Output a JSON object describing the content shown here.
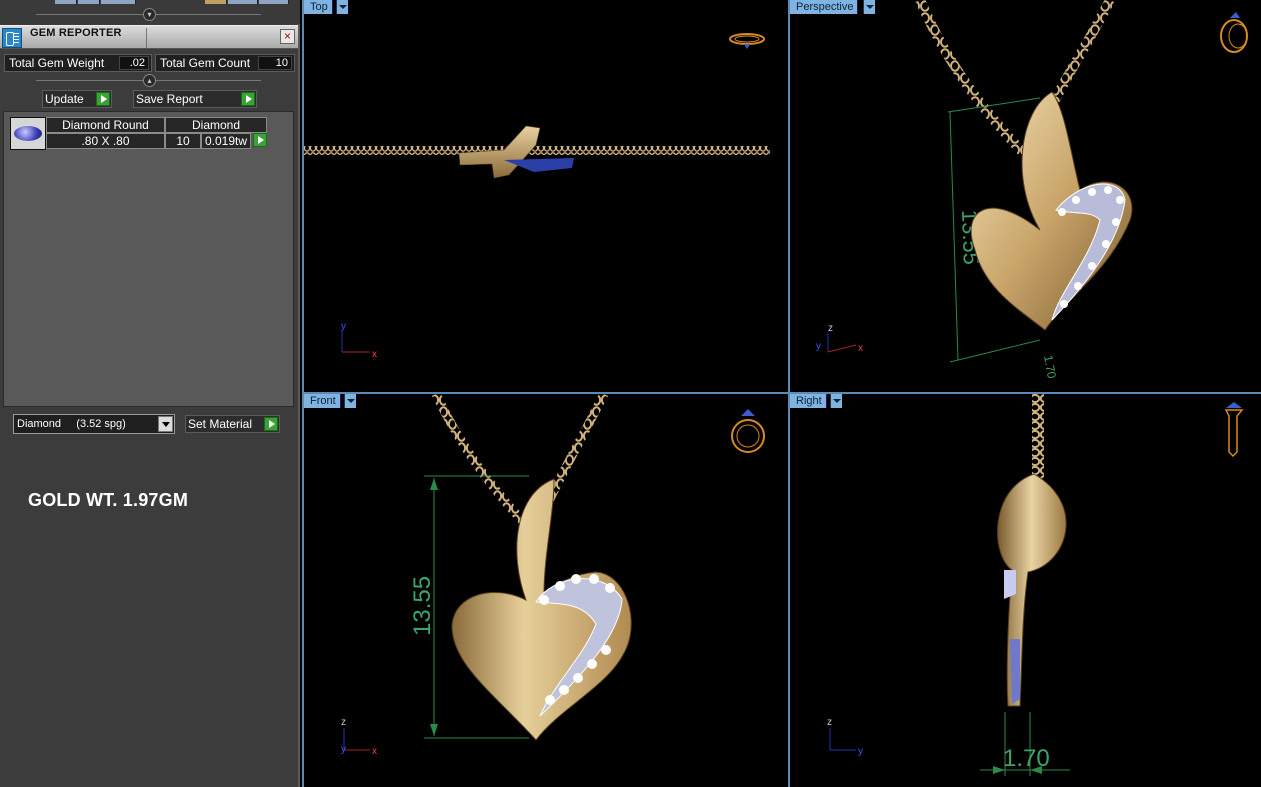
{
  "panel": {
    "title": "GEM REPORTER",
    "total_gem_weight_label": "Total Gem Weight",
    "total_gem_weight_value": ".02",
    "total_gem_count_label": "Total Gem Count",
    "total_gem_count_value": "10",
    "update_label": "Update",
    "save_report_label": "Save Report",
    "gem_row": {
      "shape_header": "Diamond Round",
      "type_header": "Diamond",
      "size": ".80 X .80",
      "count": "10",
      "weight": "0.019tw"
    },
    "material_select": "Diamond     (3.52 spg)",
    "set_material_label": "Set Material",
    "gold_weight_note": "GOLD WT. 1.97GM"
  },
  "viewports": {
    "top": {
      "label": "Top",
      "axis_a": "y",
      "axis_b": "x"
    },
    "perspective": {
      "label": "Perspective",
      "axis_a": "z",
      "axis_b": "x",
      "axis_c": "y",
      "dimension": "13.55",
      "dimension_small": "1.70"
    },
    "front": {
      "label": "Front",
      "axis_a": "z",
      "axis_b": "x",
      "axis_c": "y",
      "dimension": "13.55"
    },
    "right": {
      "label": "Right",
      "axis_a": "z",
      "axis_b": "y",
      "dimension": "1.70"
    }
  },
  "colors": {
    "gold": "#c9a56a",
    "dimension": "#3ca46a",
    "viewport_label": "#7eb3e3",
    "diamond": "#d8dcff"
  }
}
